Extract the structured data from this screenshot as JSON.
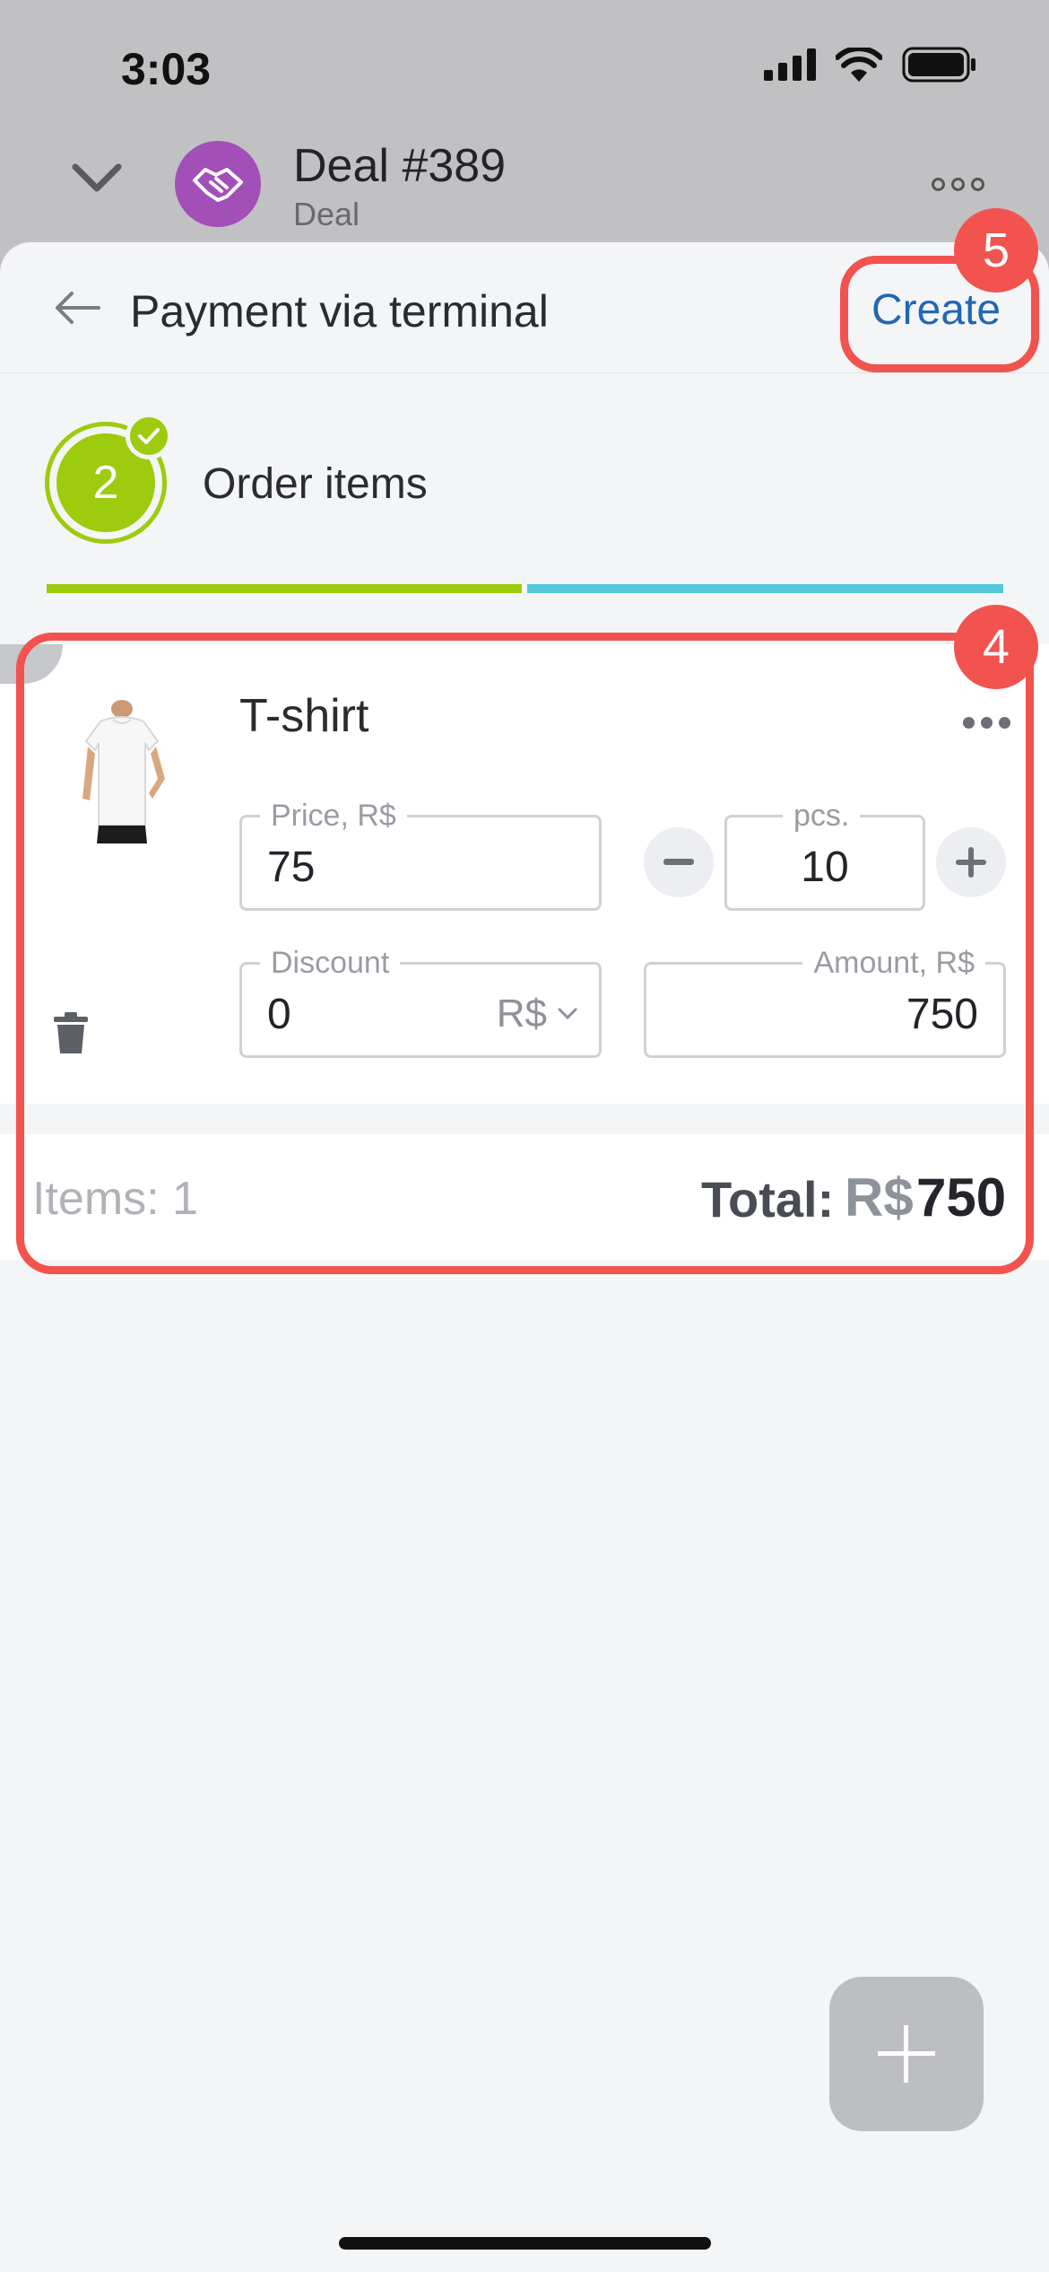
{
  "status_bar": {
    "time": "3:03"
  },
  "deal": {
    "title": "Deal #389",
    "subtitle": "Deal"
  },
  "header": {
    "title": "Payment via terminal",
    "create_label": "Create"
  },
  "annotations": {
    "create_badge": "5",
    "items_badge": "4"
  },
  "step": {
    "number": "2",
    "label": "Order items"
  },
  "item": {
    "name": "T-shirt",
    "price_label": "Price, R$",
    "price_value": "75",
    "qty_label": "pcs.",
    "qty_value": "10",
    "discount_label": "Discount",
    "discount_value": "0",
    "discount_unit": "R$",
    "amount_label": "Amount, R$",
    "amount_value": "750"
  },
  "summary": {
    "items_text": "Items: 1",
    "total_label": "Total:",
    "total_currency": "R$",
    "total_value": "750"
  },
  "colors": {
    "accent_green": "#9dcb0e",
    "accent_cyan": "#54c8d9",
    "link_blue": "#2167b4",
    "annotation_red": "#f2534f"
  }
}
